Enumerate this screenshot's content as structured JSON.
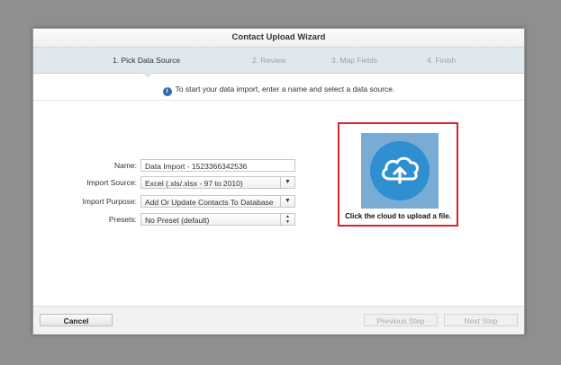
{
  "wizard": {
    "title": "Contact Upload Wizard",
    "steps": [
      {
        "label": "1. Pick Data Source",
        "active": true
      },
      {
        "label": "2. Review",
        "active": false
      },
      {
        "label": "3. Map Fields",
        "active": false
      },
      {
        "label": "4. Finish",
        "active": false
      }
    ],
    "info_text": "To start your data import, enter a name and select a data source."
  },
  "form": {
    "name_label": "Name:",
    "name_value": "Data Import - 1523366342536",
    "import_source_label": "Import Source:",
    "import_source_value": "Excel (.xls/.xlsx - 97 to 2010)",
    "import_purpose_label": "Import Purpose:",
    "import_purpose_value": "Add Or Update Contacts To Database",
    "presets_label": "Presets:",
    "presets_value": "No Preset (default)"
  },
  "upload": {
    "caption": "Click the cloud to upload a file.",
    "icon": "cloud-upload-icon",
    "highlight_color": "#d2262c"
  },
  "footer": {
    "cancel_label": "Cancel",
    "previous_label": "Previous Step",
    "next_label": "Next Step"
  },
  "icons": {
    "info": "i",
    "dropdown": "▼",
    "spinner_up": "▲",
    "spinner_down": "▼"
  }
}
